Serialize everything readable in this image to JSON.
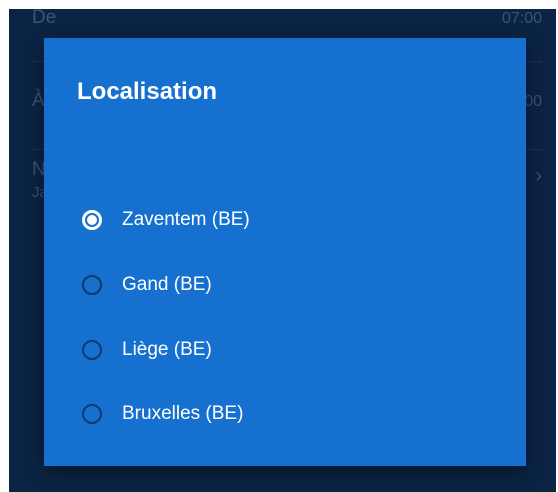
{
  "background": {
    "rows": [
      {
        "label": "De",
        "value": "07:00"
      },
      {
        "label": "À",
        "value": "00"
      },
      {
        "label": "N",
        "sub": "Ja",
        "chevron": "›"
      }
    ]
  },
  "dialog": {
    "title": "Localisation",
    "options": [
      {
        "label": "Zaventem (BE)",
        "selected": true
      },
      {
        "label": "Gand (BE)",
        "selected": false
      },
      {
        "label": "Liège (BE)",
        "selected": false
      },
      {
        "label": "Bruxelles (BE)",
        "selected": false
      }
    ]
  },
  "colors": {
    "dialog_bg": "#1670cf",
    "screen_bg": "#0e2f57",
    "radio_unselected": "#123a66",
    "radio_selected": "#ffffff"
  }
}
